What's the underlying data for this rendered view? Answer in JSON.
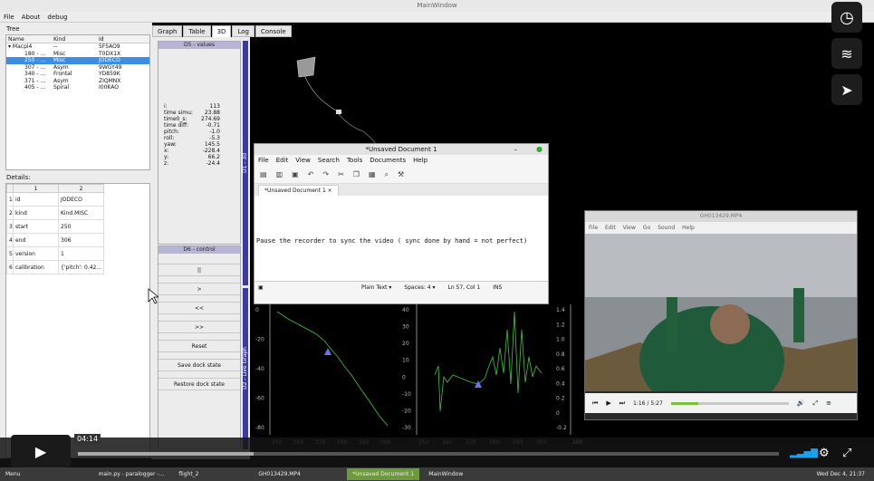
{
  "window": {
    "title": "MainWindow",
    "menu": [
      "File",
      "About",
      "debug"
    ]
  },
  "tree": {
    "label": "Tree",
    "headers": [
      "Name",
      "Kind",
      "Id"
    ],
    "rows": [
      {
        "name": "Macpi4",
        "kind": "--",
        "id": "5F5AO9",
        "indent": 0,
        "sel": false
      },
      {
        "name": "180 - ...",
        "kind": "Misc",
        "id": "T0DX1X",
        "indent": 1,
        "sel": false
      },
      {
        "name": "250 - ...",
        "kind": "Misc",
        "id": "JODECO",
        "indent": 1,
        "sel": true
      },
      {
        "name": "307 - ...",
        "kind": "Asym",
        "id": "9WGY49",
        "indent": 1,
        "sel": false
      },
      {
        "name": "340 - ...",
        "kind": "Frontal",
        "id": "YD859K",
        "indent": 1,
        "sel": false
      },
      {
        "name": "371 - ...",
        "kind": "Asym",
        "id": "ZIQMNX",
        "indent": 1,
        "sel": false
      },
      {
        "name": "405 - ...",
        "kind": "Spiral",
        "id": "I00KAO",
        "indent": 1,
        "sel": false
      }
    ]
  },
  "details": {
    "label": "Details:",
    "col_headers": [
      "1",
      "2"
    ],
    "rows": [
      [
        "id",
        "JODECO"
      ],
      [
        "kind",
        "Kind.MISC"
      ],
      [
        "start",
        "250"
      ],
      [
        "end",
        "306"
      ],
      [
        "version",
        "1"
      ],
      [
        "calibration",
        "{'pitch': 0.42..."
      ]
    ]
  },
  "tabs": [
    "Graph",
    "Table",
    "3D",
    "Log",
    "Console"
  ],
  "values_dock": {
    "title": "D5 - values",
    "rows": [
      [
        "i:",
        "113"
      ],
      [
        "time simu:",
        "23.88"
      ],
      [
        "time0_s:",
        "274.69"
      ],
      [
        "time diff:",
        "-0.71"
      ],
      [
        "",
        ""
      ],
      [
        "pitch:",
        "-1.0"
      ],
      [
        "roll:",
        "-5.3"
      ],
      [
        "yaw:",
        "145.5"
      ],
      [
        "",
        ""
      ],
      [
        "x:",
        "-228.4"
      ],
      [
        "y:",
        "66.2"
      ],
      [
        "z:",
        "-24.4"
      ]
    ]
  },
  "control_dock": {
    "title": "D6 - control",
    "buttons": [
      "||",
      ">",
      "<<",
      ">>",
      "Reset",
      "Save dock state",
      "Restore dock state"
    ]
  },
  "dock_labels": {
    "d1": "D1 - 3d",
    "d2": "D2 - Live Graph"
  },
  "editor": {
    "title": "*Unsaved Document 1",
    "menu": [
      "File",
      "Edit",
      "View",
      "Search",
      "Tools",
      "Documents",
      "Help"
    ],
    "tab": "*Unsaved Document 1",
    "text": "Pause the recorder to sync the video ( sync done by hand  = not perfect)",
    "status": [
      "Plain Text ▾",
      "Spaces: 4 ▾",
      "Ln 57, Col 1",
      "INS"
    ]
  },
  "video": {
    "title": "GH013429.MP4",
    "menu": [
      "File",
      "Edit",
      "View",
      "Go",
      "Sound",
      "Help"
    ],
    "time": "1:16 / 5:27",
    "progress": 0.23
  },
  "graphs": {
    "g1": {
      "yticks": [
        "0",
        "-20",
        "-40",
        "-60",
        "-80"
      ],
      "xticks": [
        "250",
        "260",
        "270",
        "280",
        "290",
        "300"
      ]
    },
    "g2": {
      "yticks": [
        "40",
        "30",
        "20",
        "10",
        "0",
        "-10",
        "-20",
        "-30"
      ],
      "xticks": [
        "250",
        "260",
        "270",
        "280",
        "290",
        "300"
      ]
    },
    "g3": {
      "yticks": [
        "1.4",
        "1.2",
        "1.0",
        "0.8",
        "0.6",
        "0.4",
        "0.2",
        "0",
        "-0.2"
      ],
      "xticks": [
        "250",
        "260",
        "270"
      ],
      "extra": "-200"
    }
  },
  "player": {
    "time": "04:14",
    "progress": 0.25
  },
  "taskbar": {
    "items": [
      "Menu",
      "main.py - paralogger -...",
      "flight_2",
      "GH013429.MP4",
      "*Unsaved Document 1",
      "MainWindow"
    ],
    "clock": "Wed Dec 4, 21:37"
  },
  "colors": {
    "accent": "#3d8ee0",
    "graph": "#3cc83c",
    "dockbar": "#3a3aa0"
  }
}
